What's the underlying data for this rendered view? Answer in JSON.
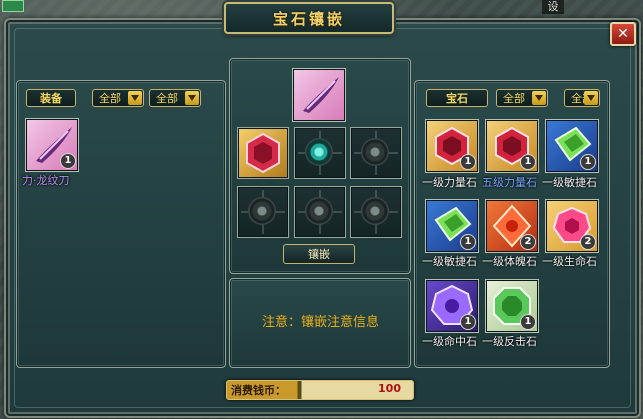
{
  "window": {
    "title": "宝石镶嵌",
    "close_label": "✕",
    "corner_tag": "设"
  },
  "left_panel": {
    "category_label": "装备",
    "filter1": "全部",
    "filter2": "全部",
    "items": [
      {
        "name": "力·龙纹刀",
        "count": "1",
        "color": "#b58cf0"
      }
    ]
  },
  "center_panel": {
    "embed_button": "镶嵌",
    "notice": "注意：镶嵌注意信息"
  },
  "right_panel": {
    "category_label": "宝石",
    "filter1": "全部",
    "filter2": "全部",
    "items": [
      {
        "name": "一级力量石",
        "count": "1",
        "gem": "red-on-gold"
      },
      {
        "name": "五级力量石",
        "count": "1",
        "gem": "red-on-gold"
      },
      {
        "name": "一级敏捷石",
        "count": "1",
        "gem": "green-on-blue"
      },
      {
        "name": "一级敏捷石",
        "count": "1",
        "gem": "green-on-blue"
      },
      {
        "name": "一级体魄石",
        "count": "2",
        "gem": "red-on-orange"
      },
      {
        "name": "一级生命石",
        "count": "2",
        "gem": "pink-on-gold"
      },
      {
        "name": "一级命中石",
        "count": "1",
        "gem": "purple"
      },
      {
        "name": "一级反击石",
        "count": "1",
        "gem": "green-on-white"
      }
    ]
  },
  "cost": {
    "label": "消费钱币：",
    "value": "100"
  }
}
